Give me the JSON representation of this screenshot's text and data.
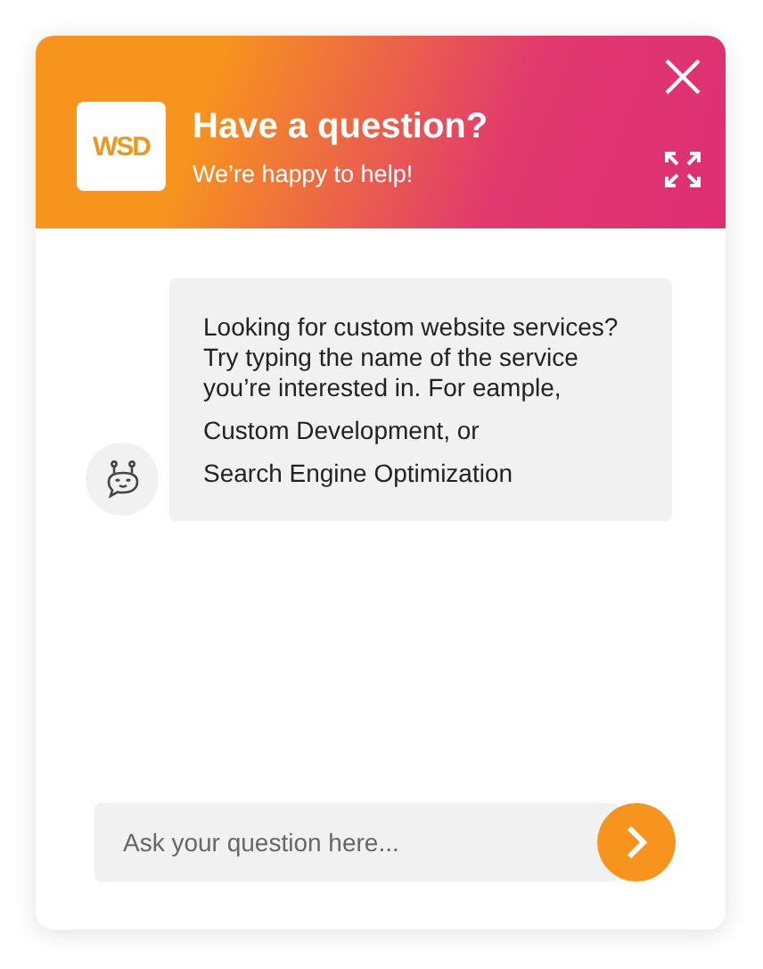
{
  "header": {
    "logo": "WSD",
    "title": "Have a question?",
    "subtitle": "We’re happy to help!"
  },
  "messages": [
    {
      "paragraphs": [
        "Looking for custom website services?\nTry typing the name of the service\nyou’re interested in. For eample,",
        "Custom Development, or",
        "Search Engine Optimization"
      ]
    }
  ],
  "input": {
    "placeholder": "Ask your question here..."
  }
}
